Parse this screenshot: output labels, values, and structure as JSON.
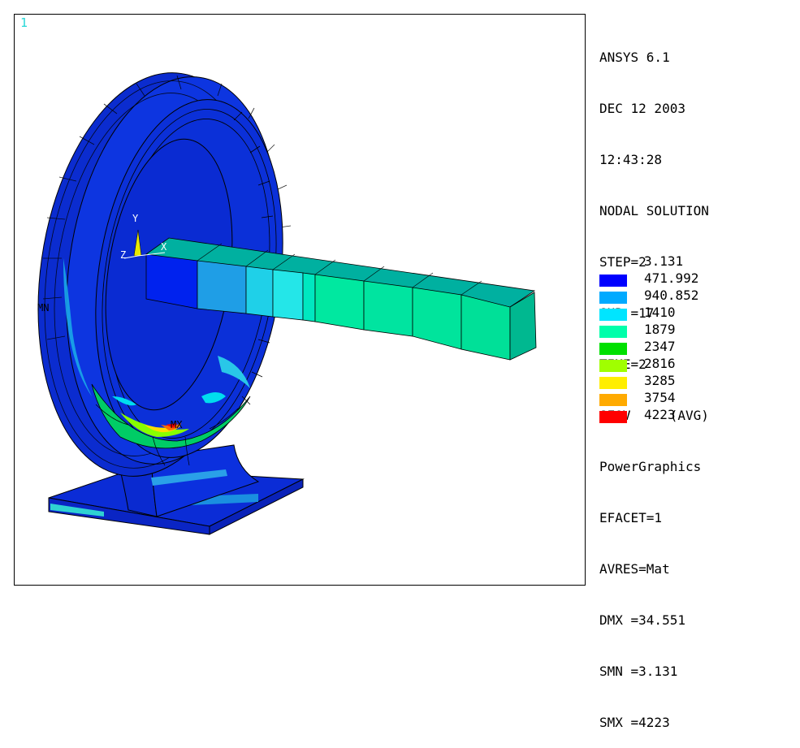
{
  "window_number": "1",
  "info_lines": [
    "ANSYS 6.1",
    "DEC 12 2003",
    "12:43:28",
    "NODAL SOLUTION",
    "STEP=2",
    "SUB =17",
    "TIME=2",
    "SEQV     (AVG)",
    "PowerGraphics",
    "EFACET=1",
    "AVRES=Mat",
    "DMX =34.551",
    "SMN =3.131",
    "SMX =4223"
  ],
  "legend": {
    "min_value": "3.131",
    "entries": [
      {
        "value": "471.992",
        "color": "#0000ff"
      },
      {
        "value": "940.852",
        "color": "#00aaff"
      },
      {
        "value": "1410",
        "color": "#00e5ff"
      },
      {
        "value": "1879",
        "color": "#00ffaa"
      },
      {
        "value": "2347",
        "color": "#00e000"
      },
      {
        "value": "2816",
        "color": "#a0ff00"
      },
      {
        "value": "3285",
        "color": "#ffee00"
      },
      {
        "value": "3754",
        "color": "#ffaa00"
      },
      {
        "value": "4223",
        "color": "#ff0000"
      }
    ]
  },
  "triad": {
    "y": "Y",
    "z": "Z",
    "x": "X"
  },
  "markers": {
    "min": "MN",
    "max": "MX"
  }
}
